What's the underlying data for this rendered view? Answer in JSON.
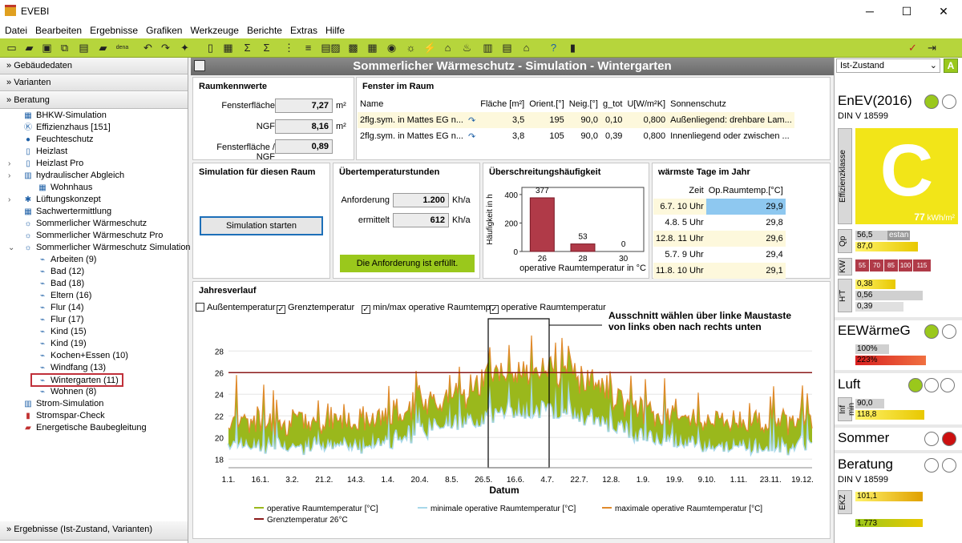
{
  "window": {
    "title": "EVEBI"
  },
  "menu": [
    "Datei",
    "Bearbeiten",
    "Ergebnisse",
    "Grafiken",
    "Werkzeuge",
    "Berichte",
    "Extras",
    "Hilfe"
  ],
  "left": {
    "acc1": "Gebäudedaten",
    "acc2": "Varianten",
    "acc3": "Beratung",
    "items": [
      "BHKW-Simulation",
      "Effizienzhaus [151]",
      "Feuchteschutz",
      "Heizlast",
      "Heizlast Pro",
      "hydraulischer Abgleich",
      "Wohnhaus",
      "Lüftungskonzept",
      "Sachwertermittlung",
      "Sommerlicher Wärmeschutz",
      "Sommerlicher Wärmeschutz Pro",
      "Sommerlicher Wärmeschutz Simulation",
      "Arbeiten (9)",
      "Bad (12)",
      "Bad (18)",
      "Eltern (16)",
      "Flur (14)",
      "Flur (17)",
      "Kind (15)",
      "Kind (19)",
      "Kochen+Essen (10)",
      "Windfang (13)",
      "Wintergarten (11)",
      "Wohnen (8)",
      "Strom-Simulation",
      "Stromspar-Check",
      "Energetische Baubegleitung"
    ],
    "footer": "Ergebnisse (Ist-Zustand, Varianten)"
  },
  "header": "Sommerlicher Wärmeschutz - Simulation - Wintergarten",
  "raum": {
    "title": "Raumkennwerte",
    "l1": "Fensterfläche",
    "v1": "7,27",
    "u1": "m²",
    "l2": "NGF",
    "v2": "8,16",
    "u2": "m²",
    "l3": "Fensterfläche / NGF",
    "v3": "0,89"
  },
  "fenster": {
    "title": "Fenster im Raum",
    "headers": [
      "Name",
      "",
      "Fläche [m²]",
      "Orient.[°]",
      "Neig.[°]",
      "g_tot",
      "U[W/m²K]",
      "Sonnenschutz"
    ],
    "rows": [
      [
        "2flg.sym. in Mattes EG n...",
        "",
        "3,5",
        "195",
        "90,0",
        "0,10",
        "0,800",
        "Außenliegend: drehbare Lam..."
      ],
      [
        "2flg.sym. in Mattes EG n...",
        "",
        "3,8",
        "105",
        "90,0",
        "0,39",
        "0,800",
        "Innenliegend oder zwischen ..."
      ]
    ]
  },
  "sim": {
    "title": "Simulation für diesen Raum",
    "button": "Simulation starten"
  },
  "ueber": {
    "title": "Übertemperaturstunden",
    "l1": "Anforderung",
    "v1": "1.200",
    "u1": "Kh/a",
    "l2": "ermittelt",
    "v2": "612",
    "u2": "Kh/a",
    "status": "Die Anforderung ist erfüllt."
  },
  "haeuf": {
    "title": "Überschreitungshäufigkeit",
    "ylabel": "Häufigkeit in h",
    "xlabel": "operative Raumtemperatur in °C",
    "yticks": [
      "400",
      "200",
      "0"
    ],
    "chart_data": {
      "type": "bar",
      "categories": [
        "26",
        "28",
        "30"
      ],
      "values": [
        377,
        53,
        0
      ],
      "ylim": [
        0,
        450
      ]
    }
  },
  "warm": {
    "title": "wärmste Tage im Jahr",
    "h1": "Zeit",
    "h2": "Op.Raumtemp.[°C]",
    "rows": [
      [
        "6.7. 10 Uhr",
        "29,9"
      ],
      [
        "4.8. 5 Uhr",
        "29,8"
      ],
      [
        "12.8. 11 Uhr",
        "29,6"
      ],
      [
        "5.7. 9 Uhr",
        "29,4"
      ],
      [
        "11.8. 10 Uhr",
        "29,1"
      ]
    ]
  },
  "jahres": {
    "title": "Jahresverlauf",
    "cb": [
      "Außentemperatur",
      "Grenztemperatur",
      "min/max operative Raumtemp.",
      "operative Raumtemperatur"
    ],
    "cbChecked": [
      false,
      true,
      true,
      true
    ],
    "annot1": "Ausschnitt wählen über linke Maustaste",
    "annot2": "von links oben nach rechts unten",
    "xlabel": "Datum",
    "xticks": [
      "1.1.",
      "16.1.",
      "3.2.",
      "21.2.",
      "14.3.",
      "1.4.",
      "20.4.",
      "8.5.",
      "26.5.",
      "16.6.",
      "4.7.",
      "22.7.",
      "12.8.",
      "1.9.",
      "19.9.",
      "9.10.",
      "1.11.",
      "23.11.",
      "19.12."
    ],
    "yticks": [
      "28",
      "26",
      "24",
      "22",
      "20",
      "18"
    ],
    "legend": [
      "operative Raumtemperatur [°C]",
      "minimale operative Raumtemperatur [°C]",
      "maximale operative Raumtemperatur [°C]",
      "Grenztemperatur 26°C"
    ],
    "chart_data": {
      "type": "line",
      "ylim": [
        17.5,
        29.8
      ],
      "grenz": 26,
      "series": [
        {
          "name": "operative Raumtemperatur [°C]",
          "color": "#9ab81c"
        },
        {
          "name": "minimale operative Raumtemperatur [°C]",
          "color": "#a8d8ea"
        },
        {
          "name": "maximale operative Raumtemperatur [°C]",
          "color": "#e08a2c"
        },
        {
          "name": "Grenztemperatur 26°C",
          "color": "#8b1a1a"
        }
      ]
    }
  },
  "right": {
    "zustand": "Ist-Zustand",
    "enev": "EnEV(2016)",
    "din": "DIN V 18599",
    "effLabel": "Effizienzklasse",
    "effClass": "C",
    "effValue": "77",
    "effUnit": "kWh/m²",
    "qp": "Qp",
    "qp1": "56,5",
    "qp1b": "estan",
    "qp2": "87,0",
    "kw": "KW",
    "kwVals": [
      "55",
      "70",
      "85",
      "100",
      "115"
    ],
    "ht": "H'T",
    "ht1": "0,38",
    "ht2": "0,56",
    "ht3": "0,39",
    "ee": "EEWärmeG",
    "ee1": "100%",
    "ee2": "223%",
    "luft": "Luft",
    "infm": "Inf min",
    "l1": "90,0",
    "l2": "118,8",
    "sommer": "Sommer",
    "beratung": "Beratung",
    "din2": "DIN V 18599",
    "ekz": "EKZ",
    "ekz1": "101,1",
    "ekz2": "1.773"
  }
}
